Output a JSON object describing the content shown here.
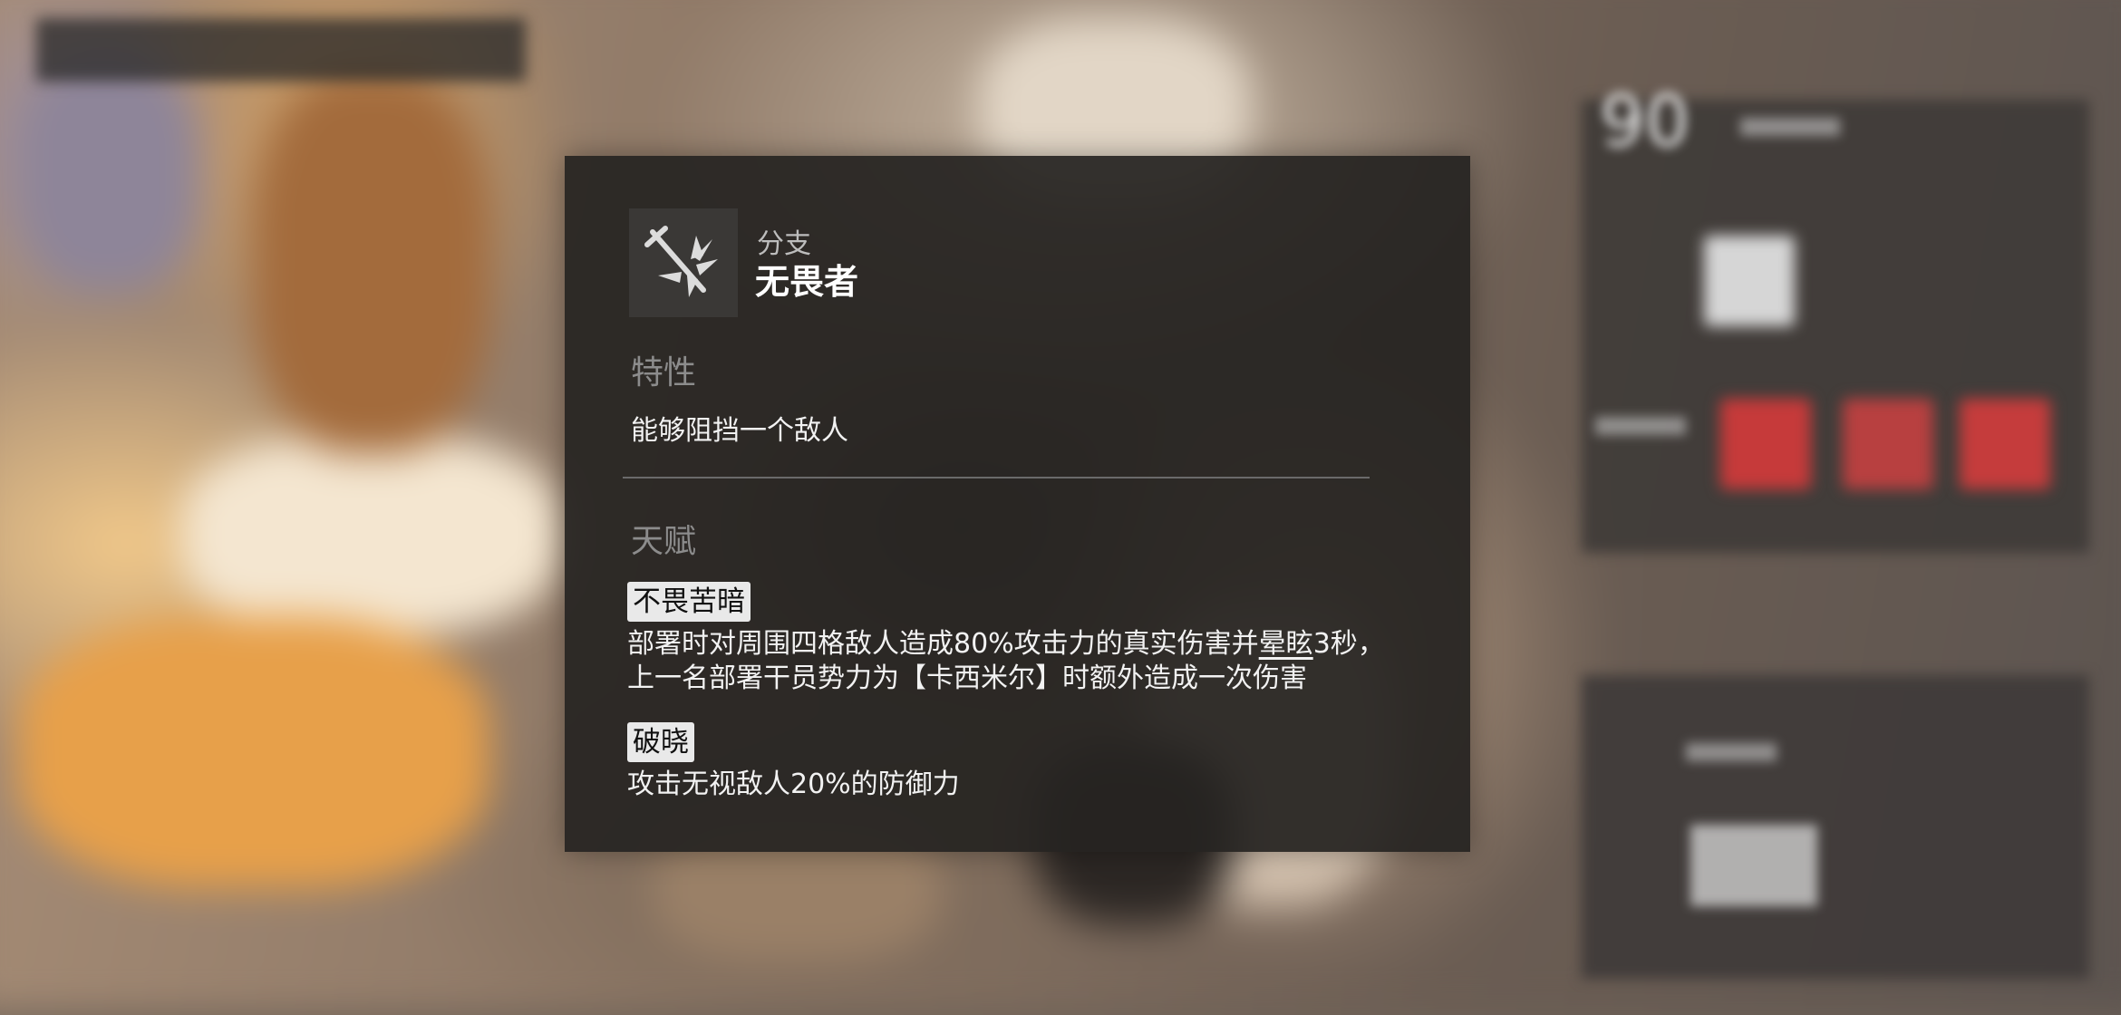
{
  "branch": {
    "label": "分支",
    "name": "无畏者",
    "icon": "sword-burst-icon"
  },
  "trait": {
    "title": "特性",
    "text": "能够阻挡一个敌人"
  },
  "talents": {
    "title": "天赋",
    "items": [
      {
        "name": "不畏苦暗",
        "desc_line1_pre": "部署时对周围四格敌人造成80%攻击力的真实伤害并",
        "desc_line1_link": "晕眩",
        "desc_line1_post": "3秒，",
        "desc_line2": "上一名部署干员势力为【卡西米尔】时额外造成一次伤害"
      },
      {
        "name": "破晓",
        "desc_line1": "攻击无视敌人20%的防御力"
      }
    ]
  },
  "background": {
    "level_number": "90"
  },
  "colors": {
    "panel_bg": "#26231f",
    "tag_bg": "#e9e9e9",
    "section_title": "#8c8c8c",
    "text": "#f2f2f2"
  }
}
